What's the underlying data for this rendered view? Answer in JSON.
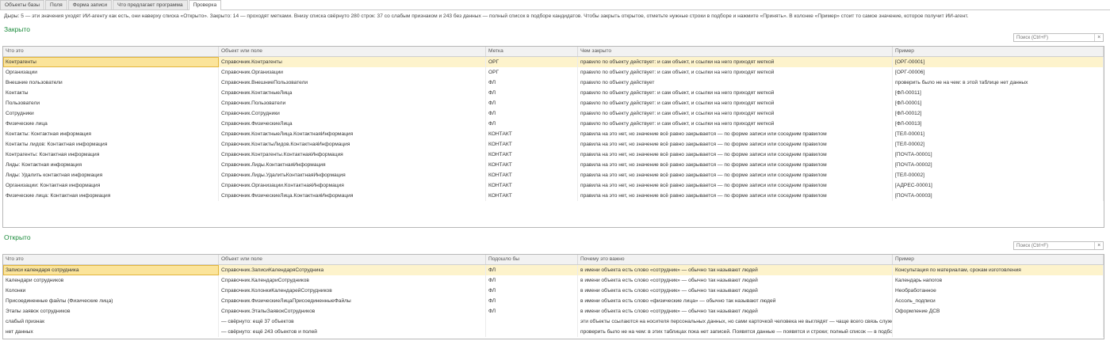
{
  "tabs": [
    "Объекты базы",
    "Поля",
    "Форма записи",
    "Что предлагает программа",
    "Проверка"
  ],
  "active_tab": 4,
  "info_text": "Дыры: 5 — эти значения уходят ИИ-агенту как есть, они наверху списка «Открыто». Закрыто: 14 — проходят метками. Внизу списка свёрнуто 280 строк: 37 со слабым признаком и 243 без данных — полный список в подборе кандидатов. Чтобы закрыть открытое, отметьте нужные строки в подборе и нажмите «Принять». В колонке «Пример» стоит то самое значение, которое получит ИИ-агент.",
  "closed": {
    "title": "Закрыто",
    "search_placeholder": "Поиск (Ctrl+F)",
    "columns": [
      "Что это",
      "Объект или поле",
      "Метка",
      "Чем закрыто",
      "Пример"
    ],
    "rows": [
      [
        "Контрагенты",
        "Справочник.Контрагенты",
        "ОРГ",
        "правило по объекту действует: и сам объект, и ссылки на него приходят меткой",
        "[ОРГ-00001]"
      ],
      [
        "Организации",
        "Справочник.Организации",
        "ОРГ",
        "правило по объекту действует: и сам объект, и ссылки на него приходят меткой",
        "[ОРГ-00006]"
      ],
      [
        "Внешние пользователи",
        "Справочник.ВнешниеПользователи",
        "ФЛ",
        "правило по объекту действует",
        "проверить было не на чем: в этой таблице нет данных"
      ],
      [
        "Контакты",
        "Справочник.КонтактныеЛица",
        "ФЛ",
        "правило по объекту действует: и сам объект, и ссылки на него приходят меткой",
        "[ФЛ-00011]"
      ],
      [
        "Пользователи",
        "Справочник.Пользователи",
        "ФЛ",
        "правило по объекту действует: и сам объект, и ссылки на него приходят меткой",
        "[ФЛ-00001]"
      ],
      [
        "Сотрудники",
        "Справочник.Сотрудники",
        "ФЛ",
        "правило по объекту действует: и сам объект, и ссылки на него приходят меткой",
        "[ФЛ-00012]"
      ],
      [
        "Физические лица",
        "Справочник.ФизическиеЛица",
        "ФЛ",
        "правило по объекту действует: и сам объект, и ссылки на него приходят меткой",
        "[ФЛ-00013]"
      ],
      [
        "Контакты: Контактная информация",
        "Справочник.КонтактныеЛица.КонтактнаяИнформация",
        "КОНТАКТ",
        "правила на это нет, но значение всё равно закрывается — по форме записи или соседним правилом",
        "[ТЕЛ-00001]"
      ],
      [
        "Контакты лидов: Контактная информация",
        "Справочник.КонтактыЛидов.КонтактнаяИнформация",
        "КОНТАКТ",
        "правила на это нет, но значение всё равно закрывается — по форме записи или соседним правилом",
        "[ТЕЛ-00002]"
      ],
      [
        "Контрагенты: Контактная информация",
        "Справочник.Контрагенты.КонтактнаяИнформация",
        "КОНТАКТ",
        "правила на это нет, но значение всё равно закрывается — по форме записи или соседним правилом",
        "[ПОЧТА-00001]"
      ],
      [
        "Лиды: Контактная информация",
        "Справочник.Лиды.КонтактнаяИнформация",
        "КОНТАКТ",
        "правила на это нет, но значение всё равно закрывается — по форме записи или соседним правилом",
        "[ПОЧТА-00002]"
      ],
      [
        "Лиды: Удалить контактная информация",
        "Справочник.Лиды.УдалитьКонтактнаяИнформация",
        "КОНТАКТ",
        "правила на это нет, но значение всё равно закрывается — по форме записи или соседним правилом",
        "[ТЕЛ-00002]"
      ],
      [
        "Организации: Контактная информация",
        "Справочник.Организации.КонтактнаяИнформация",
        "КОНТАКТ",
        "правила на это нет, но значение всё равно закрывается — по форме записи или соседним правилом",
        "[АДРЕС-00001]"
      ],
      [
        "Физические лица: Контактная информация",
        "Справочник.ФизическиеЛица.КонтактнаяИнформация",
        "КОНТАКТ",
        "правила на это нет, но значение всё равно закрывается — по форме записи или соседним правилом",
        "[ПОЧТА-00003]"
      ]
    ]
  },
  "open": {
    "title": "Открыто",
    "search_placeholder": "Поиск (Ctrl+F)",
    "columns": [
      "Что это",
      "Объект или поле",
      "Подошло бы",
      "Почему это важно",
      "Пример"
    ],
    "rows": [
      [
        "Записи календаря сотрудника",
        "Справочник.ЗаписиКалендаряСотрудника",
        "ФЛ",
        "в имени объекта есть слово «сотрудник» — обычно так называют людей",
        "Консультация по материалам, срокам изготовления"
      ],
      [
        "Календари сотрудников",
        "Справочник.КалендариСотрудников",
        "ФЛ",
        "в имени объекта есть слово «сотрудник» — обычно так называют людей",
        "Календарь напогов"
      ],
      [
        "Колонки",
        "Справочник.КолонкиКалендарейСотрудников",
        "ФЛ",
        "в имени объекта есть слово «сотрудник» — обычно так называют людей",
        "Необработанное"
      ],
      [
        "Присоединенные файлы (Физические лица)",
        "Справочник.ФизическиеЛицаПрисоединенныеФайлы",
        "ФЛ",
        "в имени объекта есть слово «физические лица» — обычно так называют людей",
        "Ассоль_подписи"
      ],
      [
        "Этапы заявок сотрудников",
        "Справочник.ЭтапыЗаявокСотрудников",
        "ФЛ",
        "в имени объекта есть слово «сотрудник» — обычно так называют людей",
        "Оформление ДСВ"
      ],
      [
        "слабый признак",
        "— свёрнуто: ещё 37 объектов",
        "",
        "эти объекты ссылаются на носителя персональных данных, но сами карточкой человека не выглядят — чаще всего связь служебная. Дырой ...",
        ""
      ],
      [
        "нет данных",
        "— свёрнуто: ещё 243 объектов и полей",
        "",
        "проверить было не на чем: в этих таблицах пока нет записей. Появятся данные — появятся и строки; полный список — в подборе кандидатов.",
        ""
      ]
    ]
  }
}
